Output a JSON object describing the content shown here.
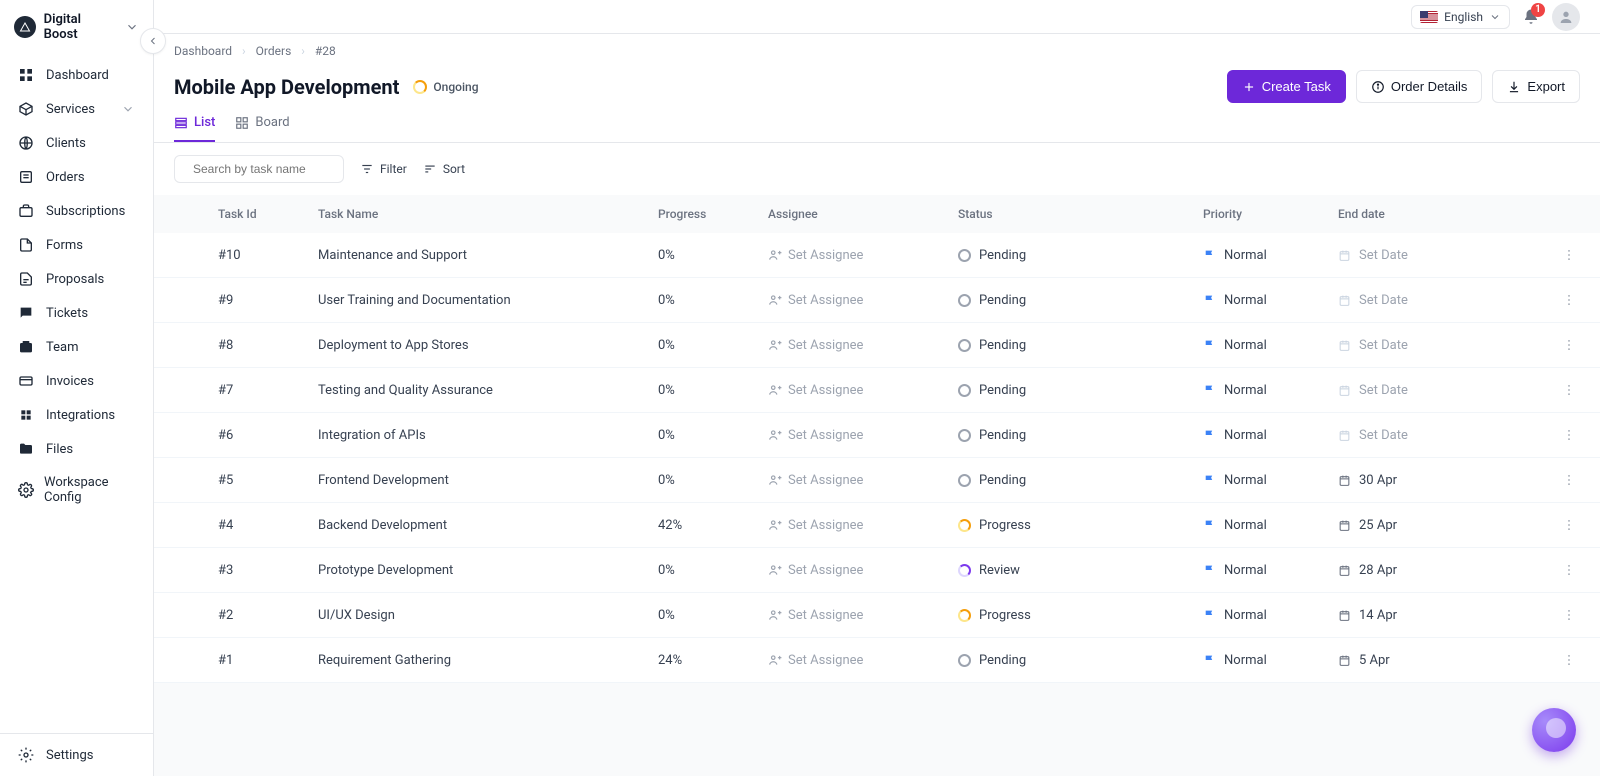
{
  "workspace": {
    "name": "Digital Boost"
  },
  "topbar": {
    "language": "English",
    "notifications": "1"
  },
  "sidebar": {
    "items": [
      {
        "label": "Dashboard"
      },
      {
        "label": "Services",
        "expandable": true
      },
      {
        "label": "Clients"
      },
      {
        "label": "Orders"
      },
      {
        "label": "Subscriptions"
      },
      {
        "label": "Forms"
      },
      {
        "label": "Proposals"
      },
      {
        "label": "Tickets"
      },
      {
        "label": "Team"
      },
      {
        "label": "Invoices"
      },
      {
        "label": "Integrations"
      },
      {
        "label": "Files"
      },
      {
        "label": "Workspace Config"
      }
    ],
    "settings": "Settings"
  },
  "breadcrumb": {
    "a": "Dashboard",
    "b": "Orders",
    "c": "#28"
  },
  "page": {
    "title": "Mobile App Development",
    "status": "Ongoing"
  },
  "actions": {
    "create": "Create Task",
    "details": "Order Details",
    "export": "Export"
  },
  "tabs": {
    "list": "List",
    "board": "Board"
  },
  "toolbar": {
    "search_placeholder": "Search by task name",
    "filter": "Filter",
    "sort": "Sort"
  },
  "table": {
    "headers": {
      "id": "Task Id",
      "name": "Task Name",
      "progress": "Progress",
      "assignee": "Assignee",
      "status": "Status",
      "priority": "Priority",
      "end": "End date"
    },
    "assignee_placeholder": "Set Assignee",
    "date_placeholder": "Set Date",
    "rows": [
      {
        "id": "#10",
        "name": "Maintenance and Support",
        "progress": "0%",
        "status": "Pending",
        "status_kind": "pending",
        "priority": "Normal",
        "end": "",
        "date_set": false
      },
      {
        "id": "#9",
        "name": "User Training and Documentation",
        "progress": "0%",
        "status": "Pending",
        "status_kind": "pending",
        "priority": "Normal",
        "end": "",
        "date_set": false
      },
      {
        "id": "#8",
        "name": "Deployment to App Stores",
        "progress": "0%",
        "status": "Pending",
        "status_kind": "pending",
        "priority": "Normal",
        "end": "",
        "date_set": false
      },
      {
        "id": "#7",
        "name": "Testing and Quality Assurance",
        "progress": "0%",
        "status": "Pending",
        "status_kind": "pending",
        "priority": "Normal",
        "end": "",
        "date_set": false
      },
      {
        "id": "#6",
        "name": "Integration of APIs",
        "progress": "0%",
        "status": "Pending",
        "status_kind": "pending",
        "priority": "Normal",
        "end": "",
        "date_set": false
      },
      {
        "id": "#5",
        "name": "Frontend Development",
        "progress": "0%",
        "status": "Pending",
        "status_kind": "pending",
        "priority": "Normal",
        "end": "30 Apr",
        "date_set": true
      },
      {
        "id": "#4",
        "name": "Backend Development",
        "progress": "42%",
        "status": "Progress",
        "status_kind": "progress",
        "priority": "Normal",
        "end": "25 Apr",
        "date_set": true
      },
      {
        "id": "#3",
        "name": "Prototype Development",
        "progress": "0%",
        "status": "Review",
        "status_kind": "review",
        "priority": "Normal",
        "end": "28 Apr",
        "date_set": true
      },
      {
        "id": "#2",
        "name": "UI/UX Design",
        "progress": "0%",
        "status": "Progress",
        "status_kind": "progress",
        "priority": "Normal",
        "end": "14 Apr",
        "date_set": true
      },
      {
        "id": "#1",
        "name": "Requirement Gathering",
        "progress": "24%",
        "status": "Pending",
        "status_kind": "pending",
        "priority": "Normal",
        "end": "5 Apr",
        "date_set": true
      }
    ]
  }
}
